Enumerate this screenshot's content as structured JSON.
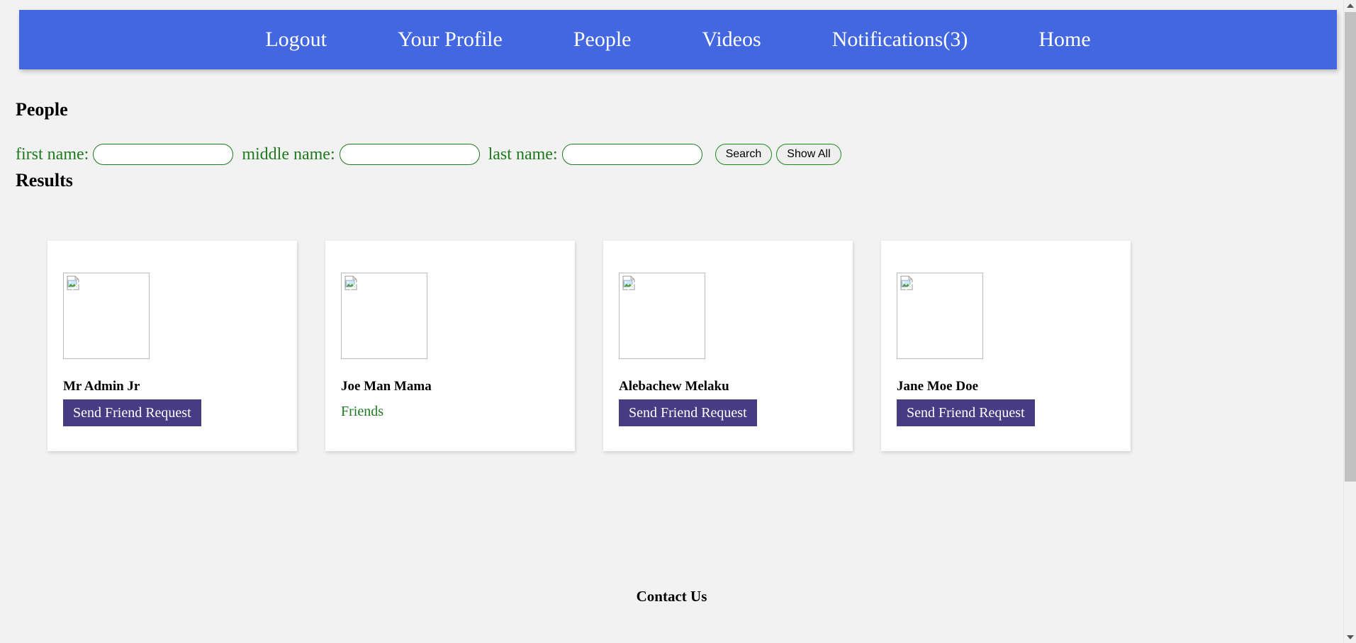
{
  "nav": {
    "items": [
      {
        "label": "Logout",
        "name": "nav-logout"
      },
      {
        "label": "Your Profile",
        "name": "nav-your-profile"
      },
      {
        "label": "People",
        "name": "nav-people"
      },
      {
        "label": "Videos",
        "name": "nav-videos"
      },
      {
        "label": "Notifications(3)",
        "name": "nav-notifications"
      },
      {
        "label": "Home",
        "name": "nav-home"
      }
    ],
    "background_color": "#4267e0",
    "text_color": "#ffffff"
  },
  "page": {
    "heading": "People",
    "results_heading": "Results",
    "background_color": "#f2f2f2"
  },
  "search": {
    "first_name": {
      "label": "first name:",
      "value": "",
      "placeholder": ""
    },
    "middle_name": {
      "label": "middle name:",
      "value": "",
      "placeholder": ""
    },
    "last_name": {
      "label": "last name:",
      "value": "",
      "placeholder": ""
    },
    "search_button": "Search",
    "show_all_button": "Show All",
    "label_color": "#1d7a1d",
    "input_border_color": "#1d7a1d"
  },
  "results": {
    "cards": [
      {
        "name": "Mr Admin Jr",
        "action_label": "Send Friend Request",
        "status_label": null,
        "image": "broken-image-placeholder"
      },
      {
        "name": "Joe Man Mama",
        "action_label": null,
        "status_label": "Friends",
        "image": "broken-image-placeholder"
      },
      {
        "name": "Alebachew Melaku",
        "action_label": "Send Friend Request",
        "status_label": null,
        "image": "broken-image-placeholder"
      },
      {
        "name": "Jane Moe Doe",
        "action_label": "Send Friend Request",
        "status_label": null,
        "image": "broken-image-placeholder"
      }
    ],
    "button_color": "#473b84",
    "status_color": "#1d7a1d"
  },
  "footer": {
    "title": "Contact Us"
  },
  "scrollbar": {
    "up_arrow": "▲",
    "down_arrow": "▼"
  }
}
